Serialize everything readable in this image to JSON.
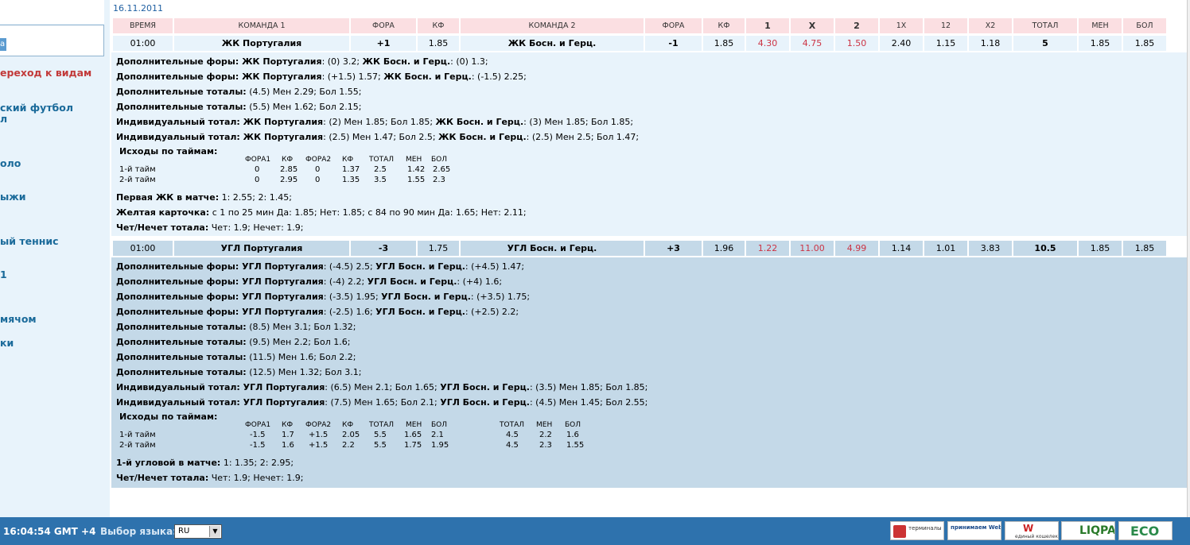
{
  "date": "16.11.2011",
  "sidebar": {
    "search_button_label": "а",
    "items": [
      "ереход к видам",
      "ский футбол",
      "л",
      "оло",
      "",
      "ыжи",
      "ый теннис",
      "1",
      "мячом",
      "ки"
    ]
  },
  "headers": [
    "ВРЕМЯ",
    "КОМАНДА 1",
    "ФОРА",
    "КФ",
    "КОМАНДА 2",
    "ФОРА",
    "КФ",
    "1",
    "X",
    "2",
    "1X",
    "12",
    "X2",
    "ТОТАЛ",
    "МЕН",
    "БОЛ"
  ],
  "events": [
    {
      "cells": [
        "01:00",
        "ЖК Португалия",
        "+1",
        "1.85",
        "ЖК Босн. и Герц.",
        "-1",
        "1.85",
        "4.30",
        "4.75",
        "1.50",
        "2.40",
        "1.15",
        "1.18",
        "5",
        "1.85",
        "1.85"
      ],
      "lines": [
        [
          [
            "b",
            "Дополнительные форы: ЖК Португалия"
          ],
          [
            "n",
            ": (0) 3.2; "
          ],
          [
            "b",
            "ЖК Босн. и Герц."
          ],
          [
            "n",
            ": (0) 1.3;"
          ]
        ],
        [
          [
            "b",
            "Дополнительные форы: ЖК Португалия"
          ],
          [
            "n",
            ": (+1.5) 1.57; "
          ],
          [
            "b",
            "ЖК Босн. и Герц."
          ],
          [
            "n",
            ": (-1.5) 2.25;"
          ]
        ],
        [
          [
            "b",
            "Дополнительные тоталы:"
          ],
          [
            "n",
            " (4.5) Мен 2.29; Бол 1.55;"
          ]
        ],
        [
          [
            "b",
            "Дополнительные тоталы:"
          ],
          [
            "n",
            " (5.5) Мен 1.62; Бол 2.15;"
          ]
        ],
        [
          [
            "b",
            "Индивидуальный тотал: ЖК Португалия"
          ],
          [
            "n",
            ": (2) Мен 1.85; Бол 1.85; "
          ],
          [
            "b",
            "ЖК Босн. и Герц."
          ],
          [
            "n",
            ": (3) Мен 1.85; Бол 1.85;"
          ]
        ],
        [
          [
            "b",
            "Индивидуальный тотал: ЖК Португалия"
          ],
          [
            "n",
            ": (2.5) Мен 1.47; Бол 2.5; "
          ],
          [
            "b",
            "ЖК Босн. и Герц."
          ],
          [
            "n",
            ": (2.5) Мен 2.5; Бол 1.47;"
          ]
        ]
      ],
      "halves_title": "Исходы по таймам:",
      "halves_headers": [
        "ФОРА1",
        "КФ",
        "ФОРА2",
        "КФ",
        "ТОТАЛ",
        "МЕН",
        "БОЛ"
      ],
      "halves": [
        {
          "label": "1-й тайм",
          "vals": [
            "0",
            "2.85",
            "0",
            "1.37",
            "2.5",
            "1.42",
            "2.65"
          ]
        },
        {
          "label": "2-й тайм",
          "vals": [
            "0",
            "2.95",
            "0",
            "1.35",
            "3.5",
            "1.55",
            "2.3"
          ]
        }
      ],
      "after": [
        [
          [
            "b",
            "Первая ЖК в матче:"
          ],
          [
            "n",
            " 1: 2.55; 2: 1.45;"
          ]
        ],
        [
          [
            "b",
            "Желтая карточка:"
          ],
          [
            "n",
            " с 1 по 25 мин Да: 1.85; Нет: 1.85; с 84 по 90 мин Да: 1.65; Нет: 2.11;"
          ]
        ],
        [
          [
            "b",
            "Чет/Нечет тотала:"
          ],
          [
            "n",
            " Чет: 1.9; Нечет: 1.9;"
          ]
        ]
      ]
    },
    {
      "cells": [
        "01:00",
        "УГЛ Португалия",
        "-3",
        "1.75",
        "УГЛ Босн. и Герц.",
        "+3",
        "1.96",
        "1.22",
        "11.00",
        "4.99",
        "1.14",
        "1.01",
        "3.83",
        "10.5",
        "1.85",
        "1.85"
      ],
      "lines": [
        [
          [
            "b",
            "Дополнительные форы: УГЛ Португалия"
          ],
          [
            "n",
            ": (-4.5) 2.5; "
          ],
          [
            "b",
            "УГЛ Босн. и Герц."
          ],
          [
            "n",
            ": (+4.5) 1.47;"
          ]
        ],
        [
          [
            "b",
            "Дополнительные форы: УГЛ Португалия"
          ],
          [
            "n",
            ": (-4) 2.2; "
          ],
          [
            "b",
            "УГЛ Босн. и Герц."
          ],
          [
            "n",
            ": (+4) 1.6;"
          ]
        ],
        [
          [
            "b",
            "Дополнительные форы: УГЛ Португалия"
          ],
          [
            "n",
            ": (-3.5) 1.95; "
          ],
          [
            "b",
            "УГЛ Босн. и Герц."
          ],
          [
            "n",
            ": (+3.5) 1.75;"
          ]
        ],
        [
          [
            "b",
            "Дополнительные форы: УГЛ Португалия"
          ],
          [
            "n",
            ": (-2.5) 1.6; "
          ],
          [
            "b",
            "УГЛ Босн. и Герц."
          ],
          [
            "n",
            ": (+2.5) 2.2;"
          ]
        ],
        [
          [
            "b",
            "Дополнительные тоталы:"
          ],
          [
            "n",
            " (8.5) Мен 3.1; Бол 1.32;"
          ]
        ],
        [
          [
            "b",
            "Дополнительные тоталы:"
          ],
          [
            "n",
            " (9.5) Мен 2.2; Бол 1.6;"
          ]
        ],
        [
          [
            "b",
            "Дополнительные тоталы:"
          ],
          [
            "n",
            " (11.5) Мен 1.6; Бол 2.2;"
          ]
        ],
        [
          [
            "b",
            "Дополнительные тоталы:"
          ],
          [
            "n",
            " (12.5) Мен 1.32; Бол 3.1;"
          ]
        ],
        [
          [
            "b",
            "Индивидуальный тотал: УГЛ Португалия"
          ],
          [
            "n",
            ": (6.5) Мен 2.1; Бол 1.65; "
          ],
          [
            "b",
            "УГЛ Босн. и Герц."
          ],
          [
            "n",
            ": (3.5) Мен 1.85; Бол 1.85;"
          ]
        ],
        [
          [
            "b",
            "Индивидуальный тотал: УГЛ Португалия"
          ],
          [
            "n",
            ": (7.5) Мен 1.65; Бол 2.1; "
          ],
          [
            "b",
            "УГЛ Босн. и Герц."
          ],
          [
            "n",
            ": (4.5) Мен 1.45; Бол 2.55;"
          ]
        ]
      ],
      "halves_title": "Исходы по таймам:",
      "halves_headers": [
        "ФОРА1",
        "КФ",
        "ФОРА2",
        "КФ",
        "ТОТАЛ",
        "МЕН",
        "БОЛ"
      ],
      "halves_headers2": [
        "ТОТАЛ",
        "МЕН",
        "БОЛ"
      ],
      "halves": [
        {
          "label": "1-й тайм",
          "vals": [
            "-1.5",
            "1.7",
            "+1.5",
            "2.05",
            "5.5",
            "1.65",
            "2.1"
          ],
          "vals2": [
            "4.5",
            "2.2",
            "1.6"
          ]
        },
        {
          "label": "2-й тайм",
          "vals": [
            "-1.5",
            "1.6",
            "+1.5",
            "2.2",
            "5.5",
            "1.75",
            "1.95"
          ],
          "vals2": [
            "4.5",
            "2.3",
            "1.55"
          ]
        }
      ],
      "after": [
        [
          [
            "b",
            "1-й угловой в матче:"
          ],
          [
            "n",
            " 1: 1.35; 2: 2.95;"
          ]
        ],
        [
          [
            "b",
            "Чет/Нечет тотала:"
          ],
          [
            "n",
            " Чет: 1.9; Нечет: 1.9;"
          ]
        ]
      ]
    }
  ],
  "footer": {
    "clock": "16:04:54  GMT +4",
    "lang_label": "Выбор языка:",
    "lang_value": "RU",
    "badges": [
      {
        "name": "terminals-badge",
        "text": "терминалы России"
      },
      {
        "name": "webmoney-badge",
        "text": "принимаем WebMoney"
      },
      {
        "name": "w1-badge",
        "text": "единый кошелек"
      },
      {
        "name": "liqpay-badge",
        "text": "LIQPAY"
      },
      {
        "name": "eco-badge",
        "text": "ECO"
      }
    ]
  }
}
